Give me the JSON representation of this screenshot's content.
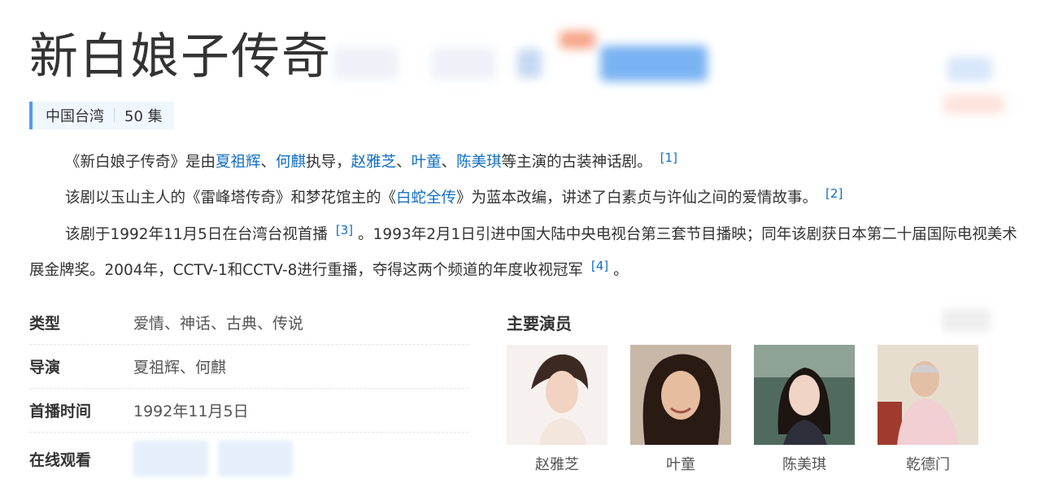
{
  "title": "新白娘子传奇",
  "subtitle": {
    "region": "中国台湾",
    "episodes": "50 集"
  },
  "intro": {
    "p1": {
      "before": "《新白娘子传奇》是由",
      "director1": "夏祖辉",
      "sep1": "、",
      "director2": "何麒",
      "mid": "执导，",
      "actor1": "赵雅芝",
      "sep2": "、",
      "actor2": "叶童",
      "sep3": "、",
      "actor3": "陈美琪",
      "after": "等主演的古装神话剧。",
      "ref": "[1]"
    },
    "p2": {
      "before": "该剧以玉山主人的《雷峰塔传奇》和梦花馆主的《",
      "link": "白蛇全传",
      "after": "》为蓝本改编，讲述了白素贞与许仙之间的爱情故事。",
      "ref": "[2]"
    },
    "p3": {
      "part1": "该剧于1992年11月5日在台湾台视首播",
      "ref1": "[3]",
      "part2": "。1993年2月1日引进中国大陆中央电视台第三套节目播映；同年该剧获日本第二十届国际电视美术展金牌奖。2004年，CCTV-1和CCTV-8进行重播，夺得这两个频道的年度收视冠军",
      "ref2": "[4]",
      "part3": "。"
    }
  },
  "info": {
    "genre_key": "类型",
    "genre_val": "爱情、神话、古典、传说",
    "director_key": "导演",
    "director_val": "夏祖辉、何麒",
    "premiere_key": "首播时间",
    "premiere_val": "1992年11月5日",
    "watch_key": "在线观看"
  },
  "cast": {
    "title": "主要演员",
    "members": [
      {
        "name": "赵雅芝"
      },
      {
        "name": "叶童"
      },
      {
        "name": "陈美琪"
      },
      {
        "name": "乾德门"
      }
    ]
  },
  "colors": {
    "link": "#136ec2",
    "accent_bar": "#4f9cee",
    "subtitle_bg": "#f0f6fd"
  }
}
